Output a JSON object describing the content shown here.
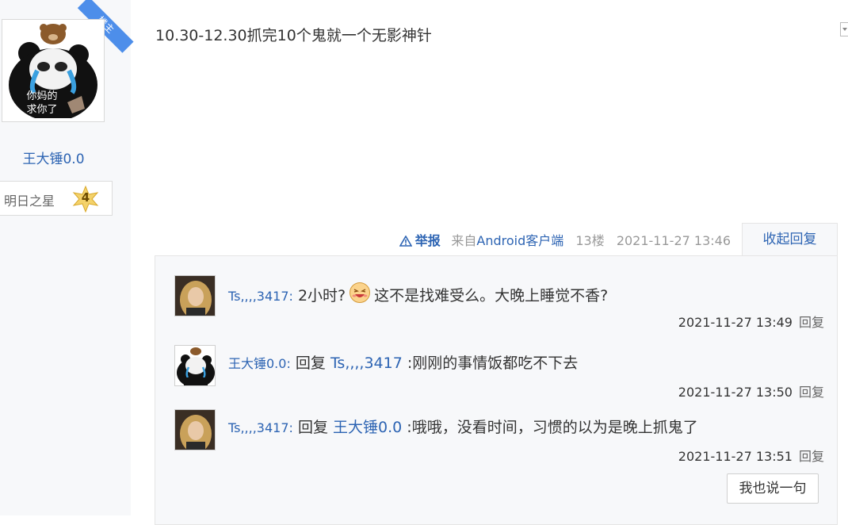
{
  "author": {
    "badge": "楼主",
    "avatar_caption_line1": "你妈的",
    "avatar_caption_line2": "求你了",
    "name": "王大锤0.0",
    "level_name": "明日之星",
    "level_num": "4"
  },
  "post": {
    "content": "10.30-12.30抓完10个鬼就一个无影神针",
    "report_label": "举报",
    "client_prefix": "来自",
    "client_name": "Android客户端",
    "floor": "13楼",
    "time": "2021-11-27 13:46",
    "collapse_label": "收起回复"
  },
  "replies": [
    {
      "user": "Ts,,,,3417:",
      "text_before": "2小时?",
      "emoji": "laugh-emoji",
      "text_after": "这不是找难受么。大晚上睡觉不香?",
      "time": "2021-11-27 13:49",
      "reply_label": "回复"
    },
    {
      "user": "王大锤0.0:",
      "prefix": "回复",
      "target": "Ts,,,,3417",
      "text": ":刚刚的事情饭都吃不下去",
      "time": "2021-11-27 13:50",
      "reply_label": "回复"
    },
    {
      "user": "Ts,,,,3417:",
      "prefix": "回复",
      "target": "王大锤0.0",
      "text": ":哦哦，没看时间，习惯的以为是晚上抓鬼了",
      "time": "2021-11-27 13:51",
      "reply_label": "回复"
    }
  ],
  "say_button": "我也说一句",
  "colors": {
    "link": "#2d64b3",
    "badge": "#4d8eea",
    "panel": "#f7f8fa"
  }
}
